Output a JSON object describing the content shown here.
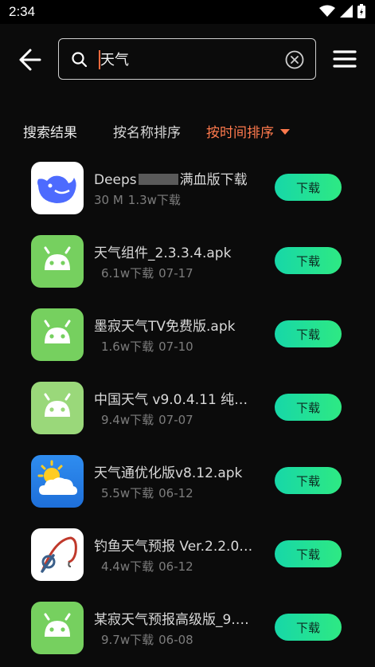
{
  "status_bar": {
    "time": "2:34"
  },
  "search": {
    "value": "天气"
  },
  "tabs": {
    "results": "搜索结果",
    "by_name": "按名称排序",
    "by_time": "按时间排序"
  },
  "download_label": "下载",
  "items": [
    {
      "name_prefix": "Deeps",
      "name_suffix": "满血版下载",
      "size": "30 M",
      "downloads": "1.3w下载",
      "date": "",
      "icon": "deepseek-whale-icon"
    },
    {
      "name": "天气组件_2.3.3.4.apk",
      "size": "",
      "downloads": "6.1w下载",
      "date": "07-17",
      "icon": "android-icon"
    },
    {
      "name": "墨寂天气TV免费版.apk",
      "size": "",
      "downloads": "1.6w下载",
      "date": "07-10",
      "icon": "android-icon"
    },
    {
      "name": "中国天气 v9.0.4.11 纯净…",
      "size": "",
      "downloads": "9.4w下载",
      "date": "07-07",
      "icon": "android-icon"
    },
    {
      "name": "天气通优化版v8.12.apk",
      "size": "",
      "downloads": "5.5w下载",
      "date": "06-12",
      "icon": "sun-cloud-icon"
    },
    {
      "name": "钓鱼天气预报 Ver.2.2.0…",
      "size": "",
      "downloads": "4.4w下载",
      "date": "06-12",
      "icon": "fishing-rod-icon"
    },
    {
      "name": "某寂天气预报高级版_9.…",
      "size": "",
      "downloads": "9.7w下载",
      "date": "06-08",
      "icon": "android-icon"
    }
  ]
}
